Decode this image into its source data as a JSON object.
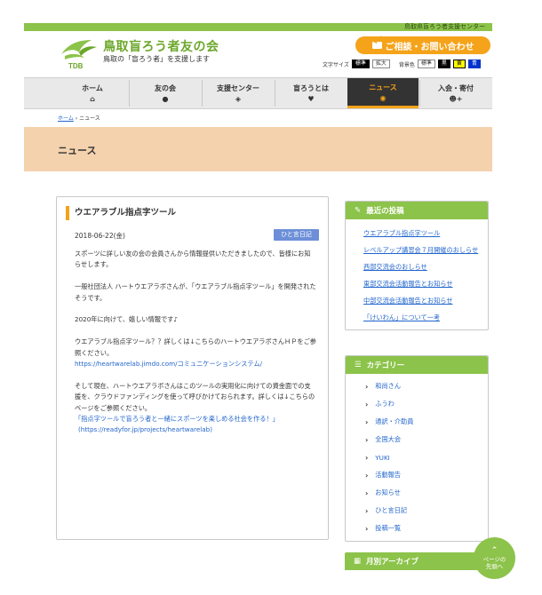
{
  "topbar": {
    "org_label": "鳥取県盲ろう者支援センター"
  },
  "header": {
    "logo_text": "TDB",
    "title": "鳥取盲ろう者友の会",
    "subtitle": "鳥取の「盲ろう者」を支援します",
    "contact_label": "ご相談・お問い合わせ",
    "font_size_label": "文字サイズ",
    "font_size_options": [
      "標準",
      "拡大"
    ],
    "bg_color_label": "背景色",
    "bg_color_options": [
      "標準",
      "黒",
      "黄",
      "青"
    ]
  },
  "nav": [
    {
      "label": "ホーム",
      "icon": "home-icon"
    },
    {
      "label": "友の会",
      "icon": "paw-icon"
    },
    {
      "label": "支援センター",
      "icon": "handshake-icon"
    },
    {
      "label": "盲ろうとは",
      "icon": "heart-icon"
    },
    {
      "label": "ニュース",
      "icon": "speech-bubble-icon",
      "active": true
    },
    {
      "label": "入会・寄付",
      "icon": "user-add-icon"
    }
  ],
  "breadcrumb": {
    "home": "ホーム",
    "sep": "›",
    "current": "ニュース"
  },
  "banner": {
    "title": "ニュース"
  },
  "article": {
    "title": "ウエアラブル指点字ツール",
    "date": "2018-06-22(金)",
    "tag": "ひと言日記",
    "p1": "スポーツに詳しい友の会の会員さんから情報提供いただきましたので、皆様にお知らせします。",
    "p2": "一般社団法人 ハートウエアラボさんが、「ウエアラブル指点字ツール」を開発されたそうです。",
    "p3": "2020年に向けて、嬉しい情報です♪",
    "p4": "ウエアラブル指点字ツール？？詳しくは↓こちらのハートウエアラボさんＨＰをご参照ください。",
    "p4_link": "https://heartwarelab.jimdo.com/コミュニケーションシステム/",
    "p5": "そして現在、ハートウエアラボさんはこのツールの実用化に向けての資金面での支援を、クラウドファンディングを使って呼びかけておられます。詳しくは↓こちらのページをご参照ください。",
    "p5_quote": "「指点字ツールで盲ろう者と一緒にスポーツを楽しめる社会を作る！」",
    "p5_url": "(https://readyfor.jp/projects/heartwarelab)"
  },
  "sidebar": {
    "recent_title": "最近の投稿",
    "recent": [
      "ウエアラブル指点字ツール",
      "レベルアップ講習会７月開催のおしらせ",
      "西部交流会のおしらせ",
      "東部交流会活動報告とお知らせ",
      "中部交流会活動報告とお知らせ",
      "「けいわん」について一考"
    ],
    "category_title": "カテゴリー",
    "categories": [
      "和尚さん",
      "ふうわ",
      "通訳・介助員",
      "全国大会",
      "YUKI",
      "活動報告",
      "お知らせ",
      "ひと言日記",
      "投稿一覧"
    ],
    "archive_title": "月別アーカイブ"
  },
  "pagetop": {
    "line1": "ページの",
    "line2": "先頭へ"
  },
  "colors": {
    "accent_green": "#8cc34a",
    "accent_orange": "#f5a31a",
    "banner": "#f4d2ae",
    "link": "#2266cc"
  }
}
